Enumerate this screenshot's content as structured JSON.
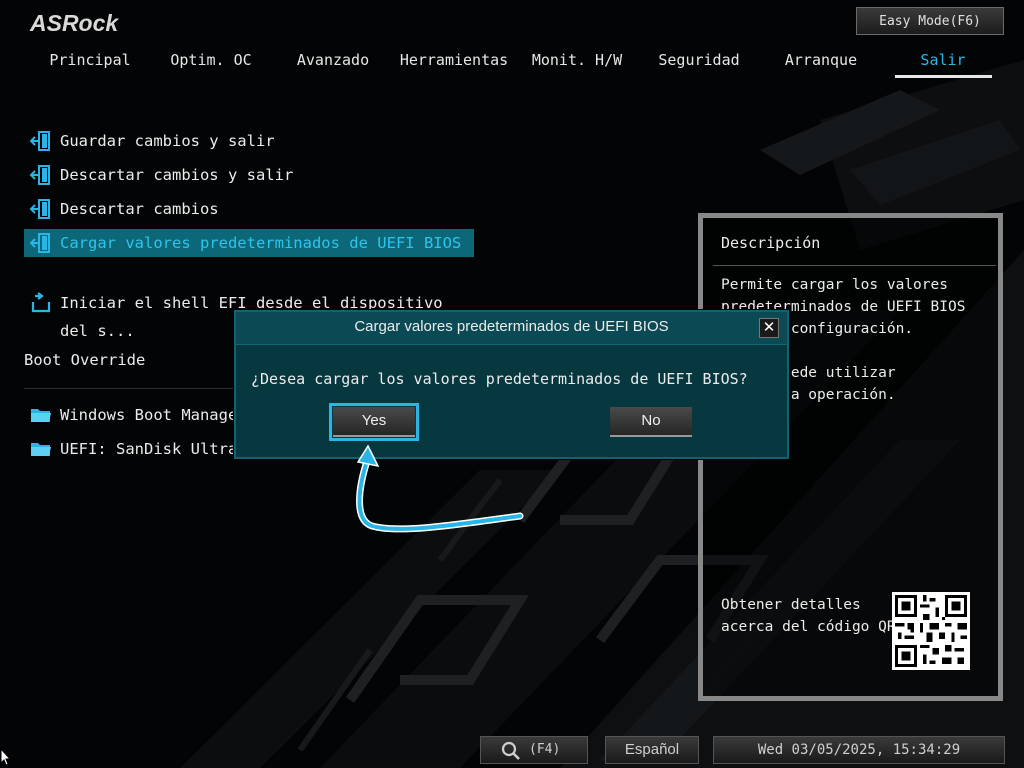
{
  "brand": "ASRock",
  "easy_mode_label": "Easy Mode(F6)",
  "nav": {
    "tabs": [
      "Principal",
      "Optim. OC",
      "Avanzado",
      "Herramientas",
      "Monit. H/W",
      "Seguridad",
      "Arranque",
      "Salir"
    ],
    "active": "Salir"
  },
  "menu": {
    "items": [
      {
        "label": "Guardar cambios y salir",
        "icon": "exit-door-icon"
      },
      {
        "label": "Descartar cambios y salir",
        "icon": "exit-door-icon"
      },
      {
        "label": "Descartar cambios",
        "icon": "exit-door-icon"
      },
      {
        "label": "Cargar valores predeterminados de UEFI BIOS",
        "icon": "exit-door-icon",
        "selected": true
      },
      {
        "label": "Iniciar el shell EFI desde el dispositivo del s...",
        "icon": "shell-launch-icon"
      }
    ],
    "boot_override_label": "Boot Override",
    "boot_items": [
      {
        "label": "Windows Boot Manager (S",
        "icon": "folder-icon"
      },
      {
        "label": "UEFI: SanDisk Ultra 11",
        "icon": "folder-icon"
      }
    ]
  },
  "description": {
    "title": "Descripción",
    "text": "Permite cargar los valores\npredeterminados de UEFI BIOS\npara la configuración.\n\nF9 se puede utilizar\npara esta operación.",
    "qr_label": "Obtener detalles\nacerca del código QR"
  },
  "dialog": {
    "title": "Cargar valores predeterminados de UEFI BIOS",
    "question": "¿Desea cargar los valores predeterminados de UEFI BIOS?",
    "yes_label": "Yes",
    "no_label": "No",
    "close_glyph": "✕"
  },
  "bottom": {
    "search_key": "(F4)",
    "language": "Español",
    "datetime": "Wed 03/05/2025, 15:34:29"
  },
  "colors": {
    "accent": "#29b6e6",
    "selected_bg": "#0c6878",
    "dialog_bg": "#07373f"
  }
}
